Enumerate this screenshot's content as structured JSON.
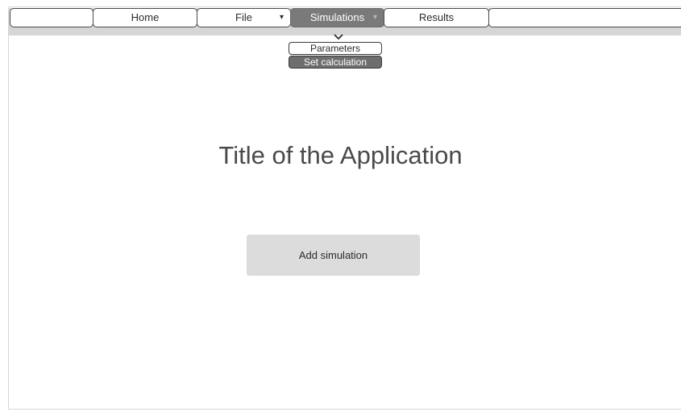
{
  "navbar": {
    "tabs": [
      {
        "label": "",
        "active": false
      },
      {
        "label": "Home",
        "active": false
      },
      {
        "label": "File",
        "active": false,
        "has_dropdown": true
      },
      {
        "label": "Simulations",
        "active": true,
        "has_dropdown": true
      },
      {
        "label": "Results",
        "active": false
      },
      {
        "label": "",
        "active": false
      }
    ],
    "dropdown_caret": "▾"
  },
  "submenu": {
    "items": [
      {
        "label": "Parameters",
        "selected": false
      },
      {
        "label": "Set calculation",
        "selected": true
      }
    ]
  },
  "main": {
    "title": "Title of the Application",
    "add_button_label": "Add simulation"
  },
  "colors": {
    "nav_strip": "#d6d6d6",
    "active_tab": "#7a7a7a",
    "selected_submenu": "#6e6e6e",
    "button_bg": "#dcdcdc",
    "title_text": "#4a4a4a"
  }
}
